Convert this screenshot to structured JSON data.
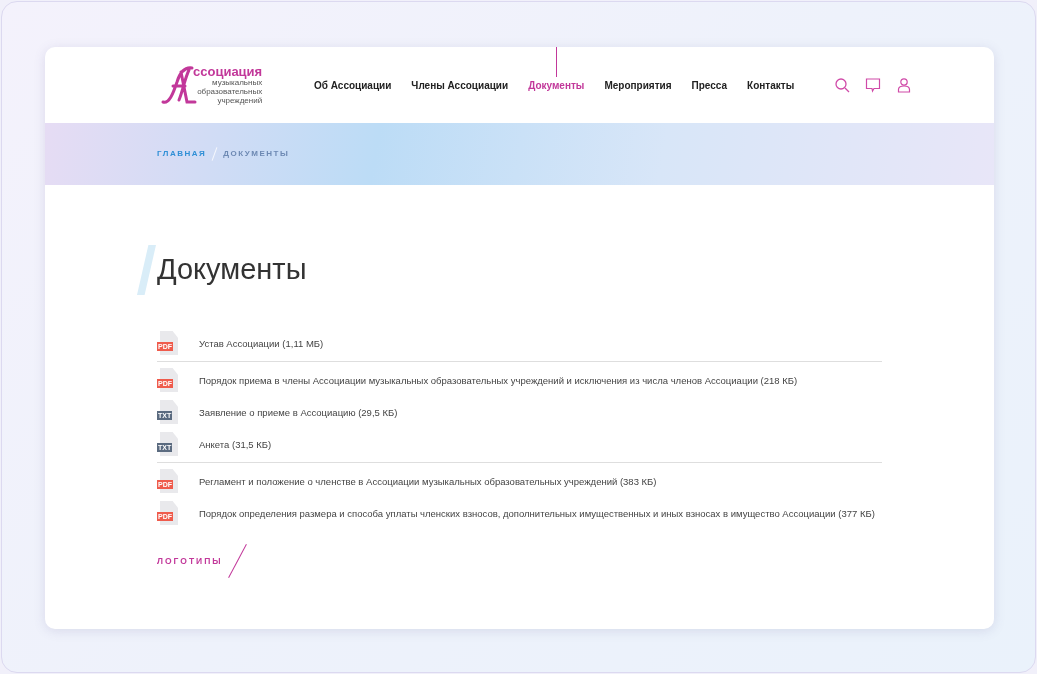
{
  "logo": {
    "title": "ссоциация",
    "subtitle": [
      "музыкальных",
      "образовательных",
      "учреждений"
    ]
  },
  "nav": [
    {
      "label": "Об Ассоциации",
      "selected": false
    },
    {
      "label": "Члены Ассоциации",
      "selected": false
    },
    {
      "label": "Документы",
      "selected": true
    },
    {
      "label": "Мероприятия",
      "selected": false
    },
    {
      "label": "Пресса",
      "selected": false
    },
    {
      "label": "Контакты",
      "selected": false
    }
  ],
  "breadcrumbs": [
    {
      "label": "ГЛАВНАЯ",
      "selected": false
    },
    {
      "label": "ДОКУМЕНТЫ",
      "selected": true
    }
  ],
  "heading": "Документы",
  "document_groups": [
    {
      "documents": [
        {
          "kind": "pdf",
          "badge": "PDF",
          "title": "Устав Ассоциации (1,11 МБ)"
        }
      ]
    },
    {
      "documents": [
        {
          "kind": "pdf",
          "badge": "PDF",
          "title": "Порядок приема в члены Ассоциации музыкальных образовательных учреждений и исключения из числа членов Ассоциации (218 КБ)"
        },
        {
          "kind": "txt",
          "badge": "TXT",
          "title": "Заявление о приеме в Ассоциацию (29,5 КБ)"
        },
        {
          "kind": "txt",
          "badge": "TXT",
          "title": "Анкета (31,5 КБ)"
        }
      ]
    },
    {
      "documents": [
        {
          "kind": "pdf",
          "badge": "PDF",
          "title": "Регламент и положение о членстве в Ассоциации музыкальных образовательных учреждений (383 КБ)"
        },
        {
          "kind": "pdf",
          "badge": "PDF",
          "title": "Порядок определения размера и способа уплаты членских взносов, дополнительных имущественных и иных взносах в имущество Ассоциации (377 КБ)"
        }
      ]
    }
  ],
  "section_link": "ЛОГОТИПЫ"
}
